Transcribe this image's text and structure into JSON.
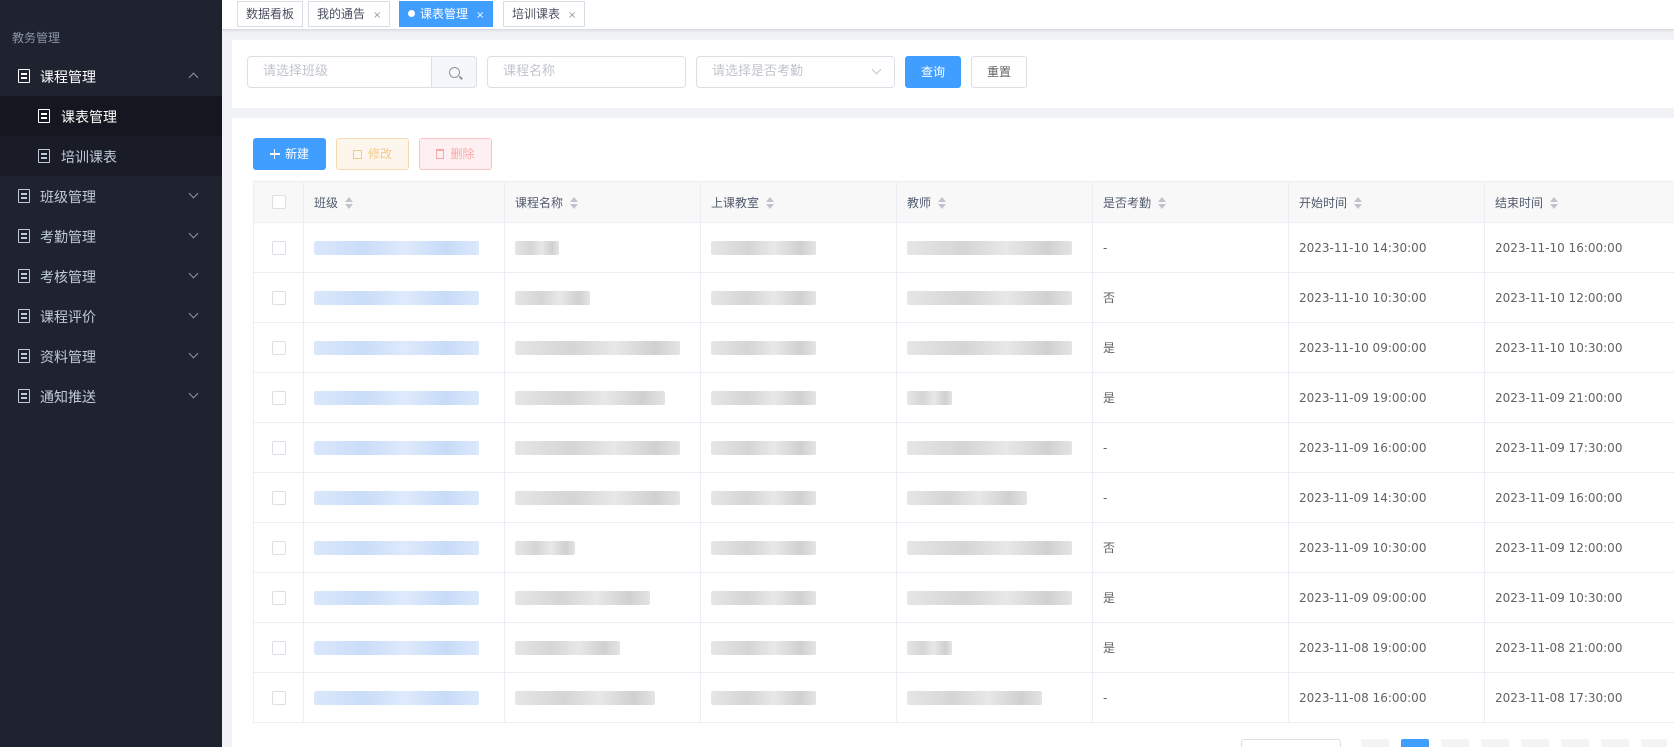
{
  "sidebar": {
    "group_title": "教务管理",
    "items": [
      {
        "label": "课程管理",
        "expanded": true,
        "children": [
          {
            "label": "课表管理",
            "active": true
          },
          {
            "label": "培训课表",
            "active": false
          }
        ]
      },
      {
        "label": "班级管理"
      },
      {
        "label": "考勤管理"
      },
      {
        "label": "考核管理"
      },
      {
        "label": "课程评价"
      },
      {
        "label": "资料管理"
      },
      {
        "label": "通知推送"
      }
    ]
  },
  "tabs": [
    {
      "label": "数据看板",
      "closable": false,
      "active": false
    },
    {
      "label": "我的通告",
      "closable": true,
      "active": false
    },
    {
      "label": "课表管理",
      "closable": true,
      "active": true
    },
    {
      "label": "培训课表",
      "closable": true,
      "active": false
    }
  ],
  "close_glyph": "×",
  "search": {
    "class_placeholder": "请选择班级",
    "course_placeholder": "课程名称",
    "attendance_placeholder": "请选择是否考勤",
    "query_label": "查询",
    "reset_label": "重置"
  },
  "toolbar": {
    "new_label": "新建",
    "edit_label": "修改",
    "delete_label": "删除"
  },
  "table": {
    "columns": [
      "班级",
      "课程名称",
      "上课教室",
      "教师",
      "是否考勤",
      "开始时间",
      "结束时间"
    ],
    "rows": [
      {
        "attendance": "-",
        "start": "2023-11-10 14:30:00",
        "end": "2023-11-10 16:00:00"
      },
      {
        "attendance": "否",
        "start": "2023-11-10 10:30:00",
        "end": "2023-11-10 12:00:00"
      },
      {
        "attendance": "是",
        "start": "2023-11-10 09:00:00",
        "end": "2023-11-10 10:30:00"
      },
      {
        "attendance": "是",
        "start": "2023-11-09 19:00:00",
        "end": "2023-11-09 21:00:00"
      },
      {
        "attendance": "-",
        "start": "2023-11-09 16:00:00",
        "end": "2023-11-09 17:30:00"
      },
      {
        "attendance": "-",
        "start": "2023-11-09 14:30:00",
        "end": "2023-11-09 16:00:00"
      },
      {
        "attendance": "否",
        "start": "2023-11-09 10:30:00",
        "end": "2023-11-09 12:00:00"
      },
      {
        "attendance": "是",
        "start": "2023-11-09 09:00:00",
        "end": "2023-11-09 10:30:00"
      },
      {
        "attendance": "是",
        "start": "2023-11-08 19:00:00",
        "end": "2023-11-08 21:00:00"
      },
      {
        "attendance": "-",
        "start": "2023-11-08 16:00:00",
        "end": "2023-11-08 17:30:00"
      }
    ]
  },
  "colors": {
    "sidebar_bg": "#1f2330",
    "primary": "#409eff",
    "warning_plain": "#fdf6ec",
    "danger_plain": "#fef0f0"
  }
}
